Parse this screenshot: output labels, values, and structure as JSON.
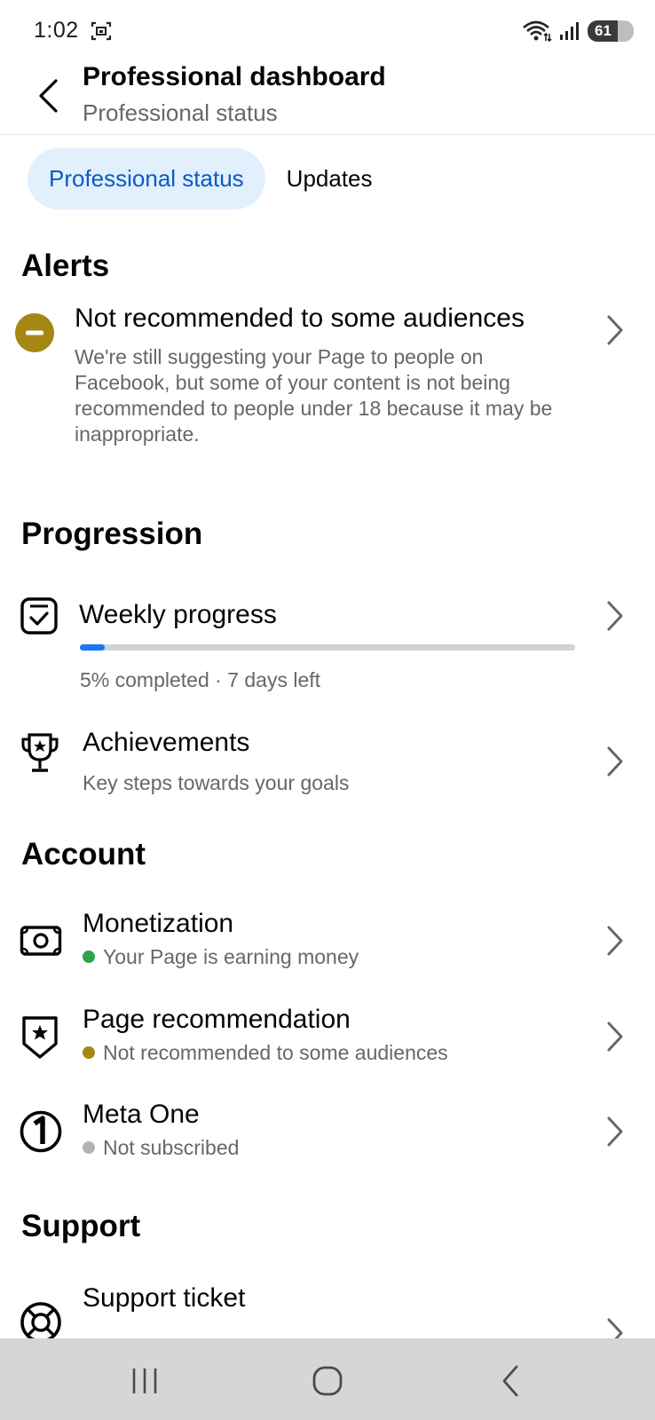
{
  "status_bar": {
    "time": "1:02",
    "battery": "61"
  },
  "header": {
    "title": "Professional dashboard",
    "subtitle": "Professional status"
  },
  "tabs": [
    {
      "label": "Professional status",
      "active": true
    },
    {
      "label": "Updates",
      "active": false
    }
  ],
  "alerts": {
    "title": "Alerts",
    "item": {
      "title": "Not recommended to some audiences",
      "desc_lines": [
        "We're still suggesting your Page to people on",
        "Facebook, but some of your content is not being",
        "recommended to people under 18 because it may be",
        "inappropriate."
      ]
    }
  },
  "progression": {
    "title": "Progression",
    "weekly": {
      "title": "Weekly progress",
      "progress_fraction": 0.05,
      "status": "5% completed · 7 days left"
    },
    "achievements": {
      "title": "Achievements",
      "subtitle": "Key steps towards your goals"
    }
  },
  "account": {
    "title": "Account",
    "monetization": {
      "title": "Monetization",
      "status": "Your Page is earning money",
      "dot_color": "#31a24c"
    },
    "recommendation": {
      "title": "Page recommendation",
      "status": "Not recommended to some audiences",
      "dot_color": "#a48813"
    },
    "meta_one": {
      "title": "Meta One",
      "status": "Not subscribed",
      "dot_color": "#b0b3b8"
    }
  },
  "support": {
    "title": "Support",
    "ticket": {
      "title": "Support ticket"
    }
  },
  "colors": {
    "accent": "#1877f2",
    "tab_bg": "#e2effd",
    "alert_icon": "#a48813"
  }
}
